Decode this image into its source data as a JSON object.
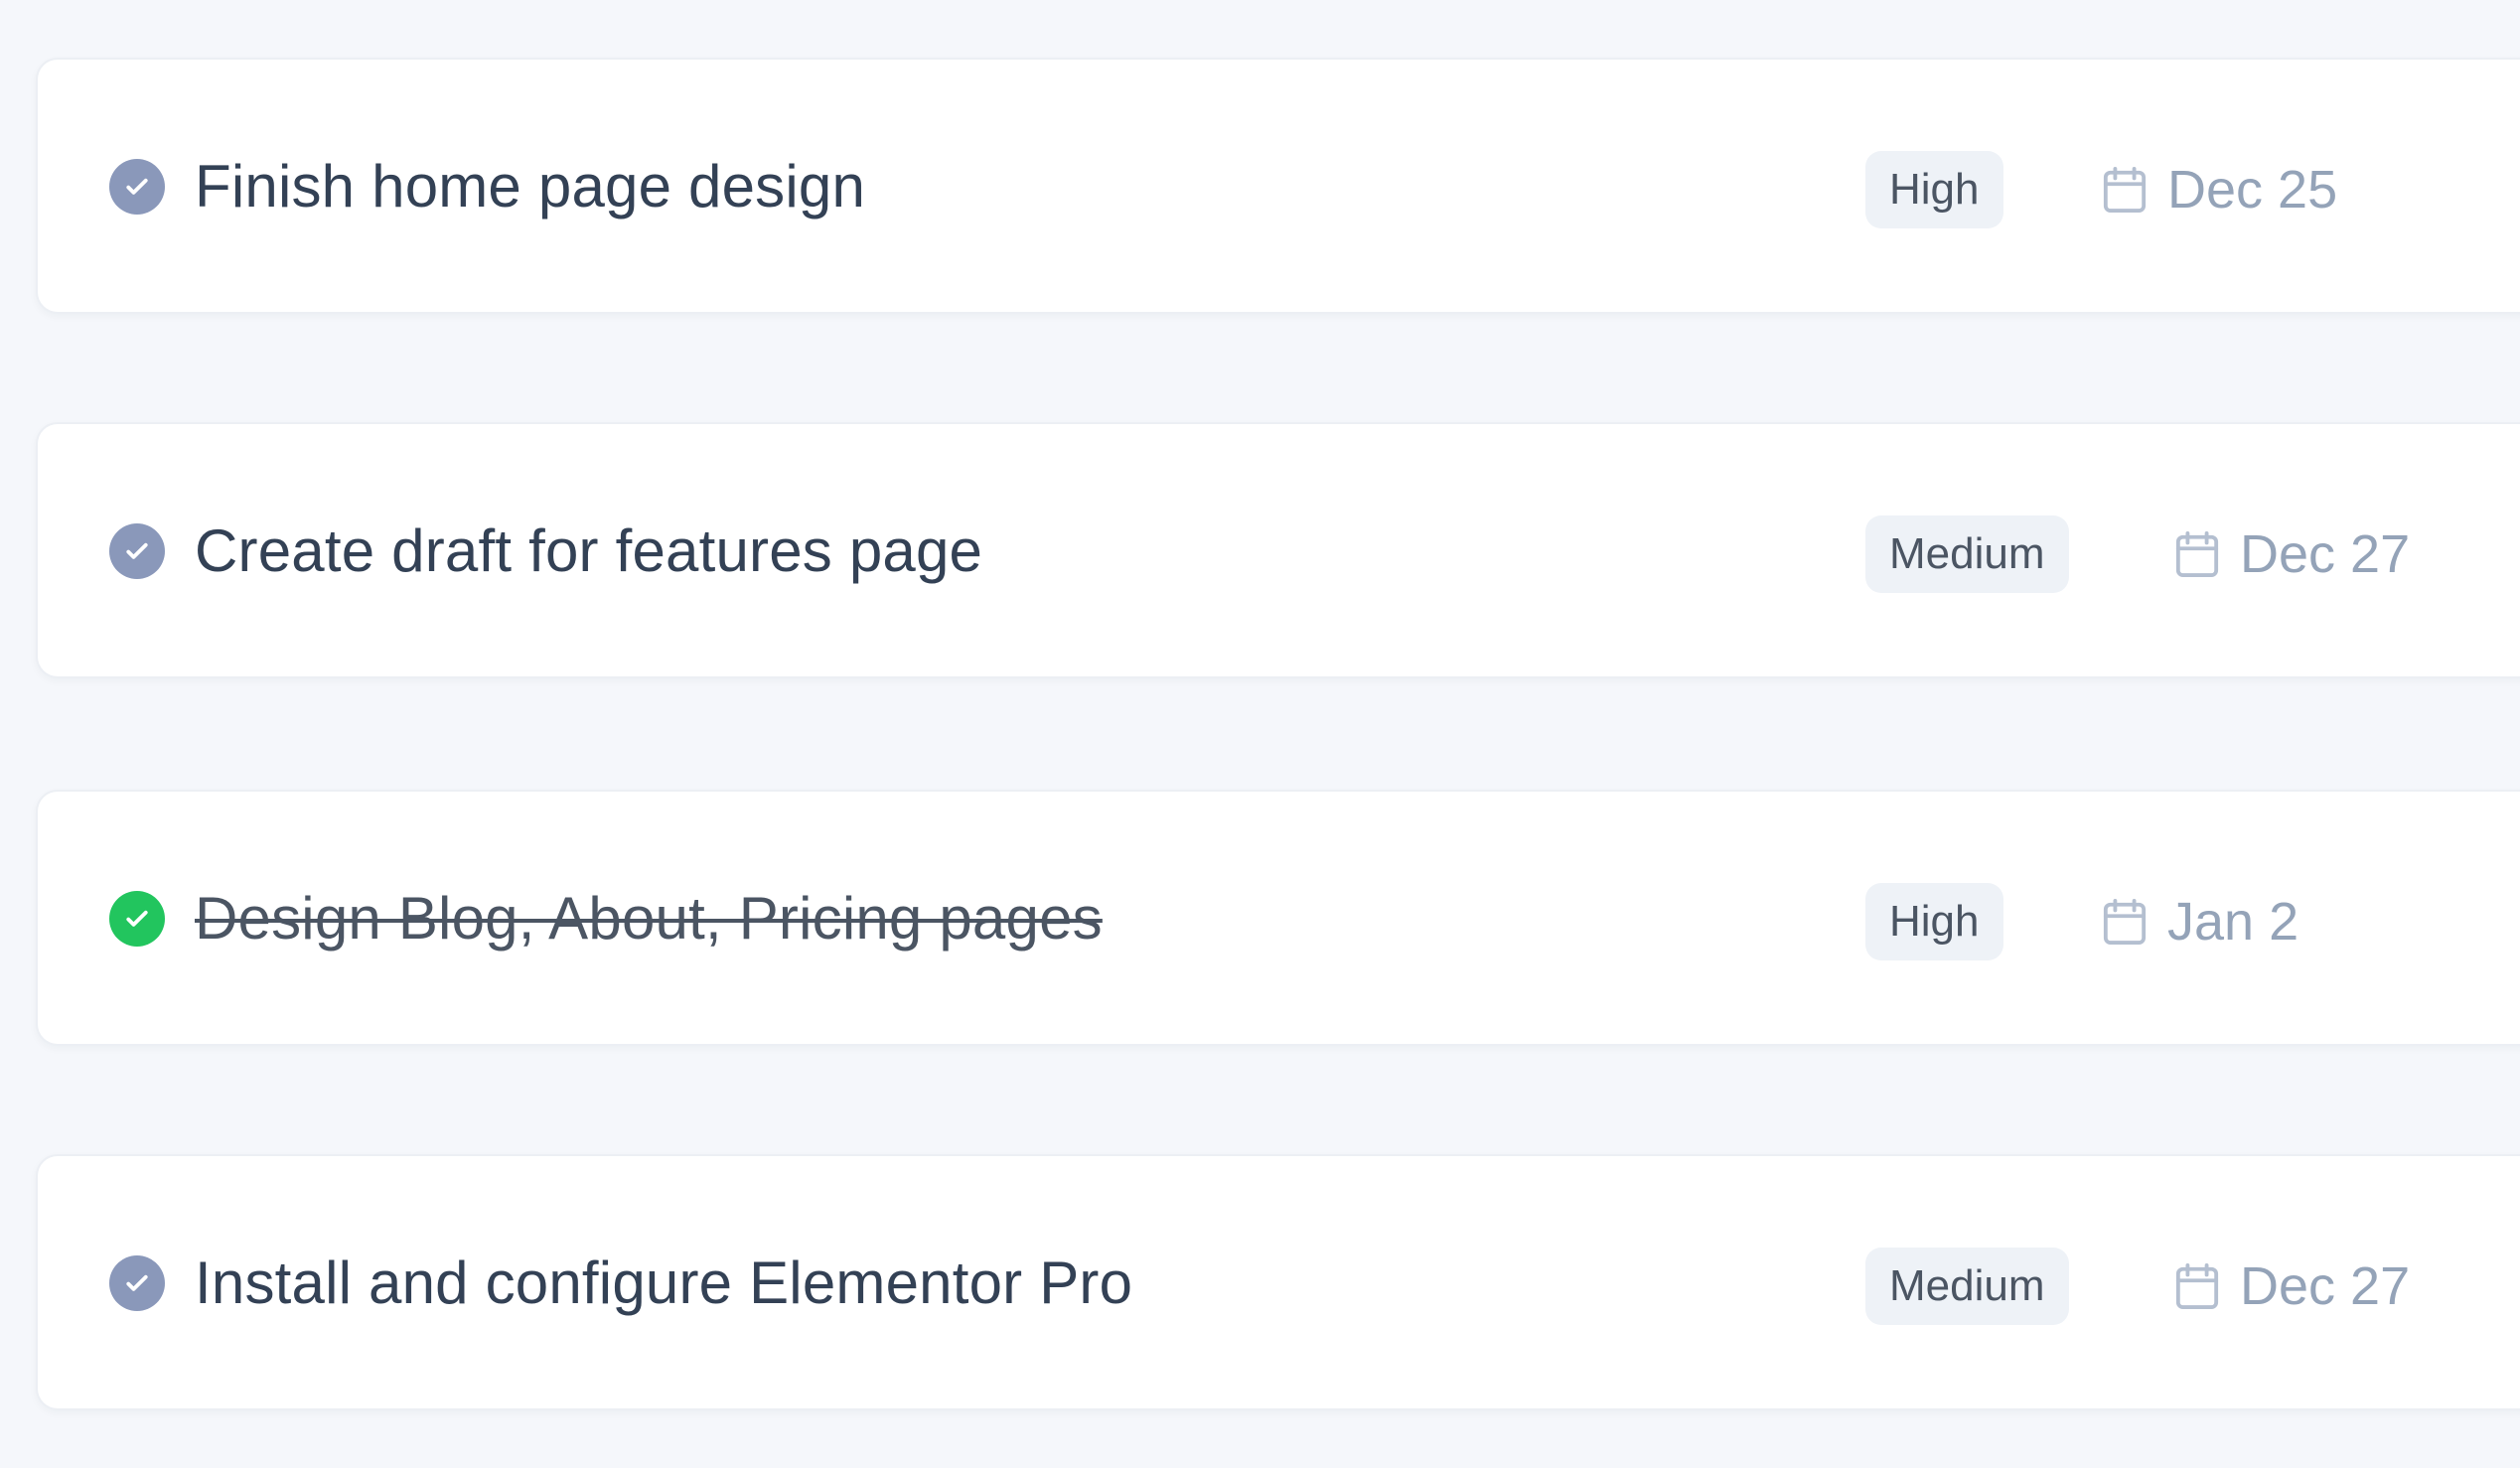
{
  "colors": {
    "background": "#f5f7fb",
    "card": "#ffffff",
    "pending_check": "#8a98ba",
    "completed_check": "#22c55e",
    "badge_background": "#eef2f7",
    "date_text": "#94a3b8"
  },
  "tasks": [
    {
      "title": "Finish home page design",
      "priority": "High",
      "due_date": "Dec 25",
      "status_icon": "pending-check-icon",
      "completed": false
    },
    {
      "title": "Create draft for features page",
      "priority": "Medium",
      "due_date": "Dec 27",
      "status_icon": "pending-check-icon",
      "completed": false
    },
    {
      "title": "Design Blog, About, Pricing pages",
      "priority": "High",
      "due_date": "Jan 2",
      "status_icon": "completed-check-icon",
      "completed": true
    },
    {
      "title": "Install and configure Elementor Pro",
      "priority": "Medium",
      "due_date": "Dec 27",
      "status_icon": "pending-check-icon",
      "completed": false
    }
  ]
}
